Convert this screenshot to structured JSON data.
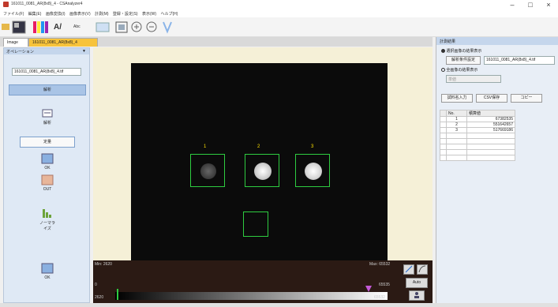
{
  "window": {
    "title": "161011_0081_AR(8x8)_4 - CSAnalyzer4",
    "minimize": "–",
    "maximize": "□",
    "close": "×"
  },
  "menu": [
    "ファイル(F)",
    "編集(E)",
    "画像変換(I)",
    "画像表示(V)",
    "計測(M)",
    "登録・設定(S)",
    "表示(W)",
    "ヘルプ(H)"
  ],
  "toolbar": {
    "text_tool": "A/",
    "abc_tool": "Abc"
  },
  "tabs": {
    "image": "Image",
    "file": "161011_0081_AR(8x8)_4"
  },
  "left_panel": {
    "header": "オペレーション",
    "pin": "▼",
    "file_combo": "161011_0081_AR(8x8)_4.tif",
    "analyze_button": "解析",
    "analyze_icon_label": "解析",
    "quant_tab": "定量",
    "ok_label": "OK",
    "out_label": "OUT",
    "noise_label": "ノーマライズ",
    "bottom_ok_label": "OK"
  },
  "viewer": {
    "roi_labels": [
      "1",
      "2",
      "3"
    ],
    "histogram": {
      "min_label": "Min: 2620",
      "max_label": "Max: 65532",
      "left_value": "0",
      "right_value": "65535",
      "bottom_left": "2620",
      "bottom_right": "65532",
      "auto_label": "Auto"
    }
  },
  "right_panel": {
    "title": "計測結果",
    "radio_selected": "選択画像の結果表示",
    "analysis_button": "解析条件設定",
    "file_combo": "161011_0081_AR(8x8)_4.tif",
    "radio_all": "全画像の結果表示",
    "disabled_combo": "単値",
    "button_group": "試料名入力",
    "button_csv": "CSV保存",
    "button_copy": "コピー",
    "table": {
      "headers": [
        "No.",
        "積算値"
      ],
      "rows": [
        [
          "1",
          "67382535"
        ],
        [
          "2",
          "551642657"
        ],
        [
          "3",
          "517669186"
        ]
      ]
    }
  },
  "colors": {
    "accent": "#2ecc40",
    "tab_highlight": "#f7c33b",
    "panel_blue": "#a9c4e6"
  }
}
